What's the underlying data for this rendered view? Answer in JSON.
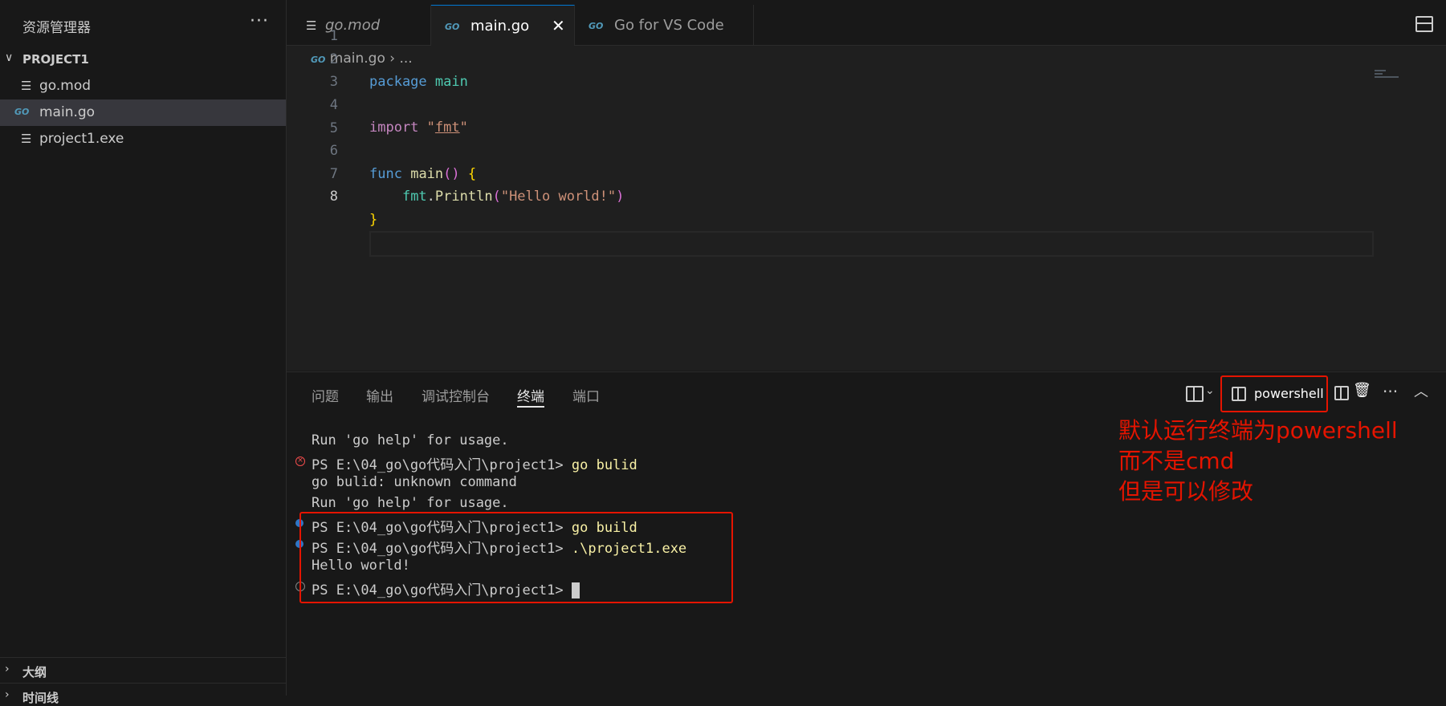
{
  "sidebar": {
    "title": "资源管理器",
    "more_glyph": "···",
    "project_name": "PROJECT1",
    "files": [
      {
        "name": "go.mod",
        "icon": "file-lines-icon"
      },
      {
        "name": "main.go",
        "icon": "go-icon",
        "icon_text": "GO"
      },
      {
        "name": "project1.exe",
        "icon": "file-lines-icon"
      }
    ],
    "outline_label": "大纲",
    "timeline_label": "时间线"
  },
  "tabs": [
    {
      "label": "go.mod",
      "icon": "file-lines-icon"
    },
    {
      "label": "main.go",
      "icon": "go-icon",
      "icon_text": "GO",
      "close_glyph": "✕"
    },
    {
      "label": "Go for VS Code",
      "icon": "go-icon",
      "icon_text": "GO"
    }
  ],
  "breadcrumb": {
    "icon_text": "GO",
    "file": "main.go",
    "separator": "›",
    "rest": "..."
  },
  "editor": {
    "line_numbers": [
      "1",
      "2",
      "3",
      "4",
      "5",
      "6",
      "7",
      "8"
    ],
    "current_line": "8",
    "code": {
      "l1_kw": "package",
      "l1_name": "main",
      "l3_kw": "import",
      "l3_q1": "\"",
      "l3_pkg": "fmt",
      "l3_q2": "\"",
      "l5_kw": "func",
      "l5_name": "main",
      "l5_open": "(",
      "l5_close": ")",
      "l5_brace": "{",
      "l6_indent": "    ",
      "l6_pkg": "fmt",
      "l6_dot": ".",
      "l6_fn": "Println",
      "l6_open": "(",
      "l6_str": "\"Hello world!\"",
      "l6_close": ")",
      "l7_brace": "}"
    }
  },
  "panel": {
    "tabs": [
      "问题",
      "输出",
      "调试控制台",
      "终端",
      "端口"
    ],
    "active_tab": "终端",
    "profile": "powershell",
    "actions": {
      "more": "···",
      "maximize": "︿",
      "trash": "🗑",
      "chevron": "⌄"
    },
    "terminal": [
      {
        "text": "Run 'go help' for usage.",
        "deco": "none"
      },
      {
        "prompt": "PS E:\\04_go\\go代码入门\\project1> ",
        "cmd": "go bulid",
        "deco": "error"
      },
      {
        "text": "go bulid: unknown command",
        "deco": "none"
      },
      {
        "text": "Run 'go help' for usage.",
        "deco": "none"
      },
      {
        "prompt": "PS E:\\04_go\\go代码入门\\project1> ",
        "cmd": "go build",
        "deco": "success"
      },
      {
        "prompt": "PS E:\\04_go\\go代码入门\\project1> ",
        "cmd": ".\\project1.exe",
        "deco": "success"
      },
      {
        "text": "Hello world!",
        "deco": "none"
      },
      {
        "prompt": "PS E:\\04_go\\go代码入门\\project1> ",
        "cmd": "",
        "deco": "empty"
      }
    ]
  },
  "annotation": {
    "line1": "默认运行终端为powershell",
    "line2": "而不是cmd",
    "line3": "但是可以修改"
  },
  "colors": {
    "accent": "#0078d4",
    "annotation_red": "#e51400",
    "terminal_cmd": "#f9f1a5"
  }
}
